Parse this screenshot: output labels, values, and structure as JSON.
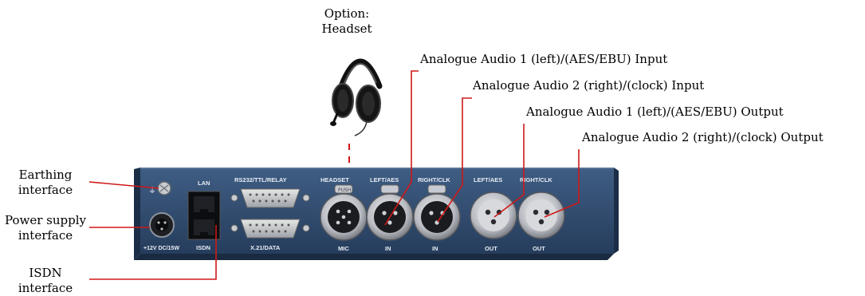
{
  "callouts": {
    "option_headset": [
      "Option:",
      "Headset"
    ],
    "in1": "Analogue Audio 1 (left)/(AES/EBU) Input",
    "in2": "Analogue Audio 2 (right)/(clock) Input",
    "out1": "Analogue Audio 1 (left)/(AES/EBU) Output",
    "out2": "Analogue Audio 2 (right)/(clock) Output",
    "earthing": [
      "Earthing",
      "interface"
    ],
    "power": [
      "Power supply",
      "interface"
    ],
    "isdn": [
      "ISDN",
      "interface"
    ]
  },
  "panel": {
    "lan": "LAN",
    "isdn": "ISDN",
    "power": "+12V DC/15W",
    "rs232": "RS232/TTL/RELAY",
    "x21": "X.21/DATA",
    "headset": "HEADSET",
    "mic": "MIC",
    "left_aes_in": "LEFT/AES",
    "right_clk_in": "RIGHT/CLK",
    "left_aes_out": "LEFT/AES",
    "right_clk_out": "RIGHT/CLK",
    "in_a": "IN",
    "in_b": "IN",
    "out_a": "OUT",
    "out_b": "OUT",
    "push": "PUSH"
  },
  "colors": {
    "panel": "#2f4a6e",
    "callout_line": "#d01818"
  }
}
